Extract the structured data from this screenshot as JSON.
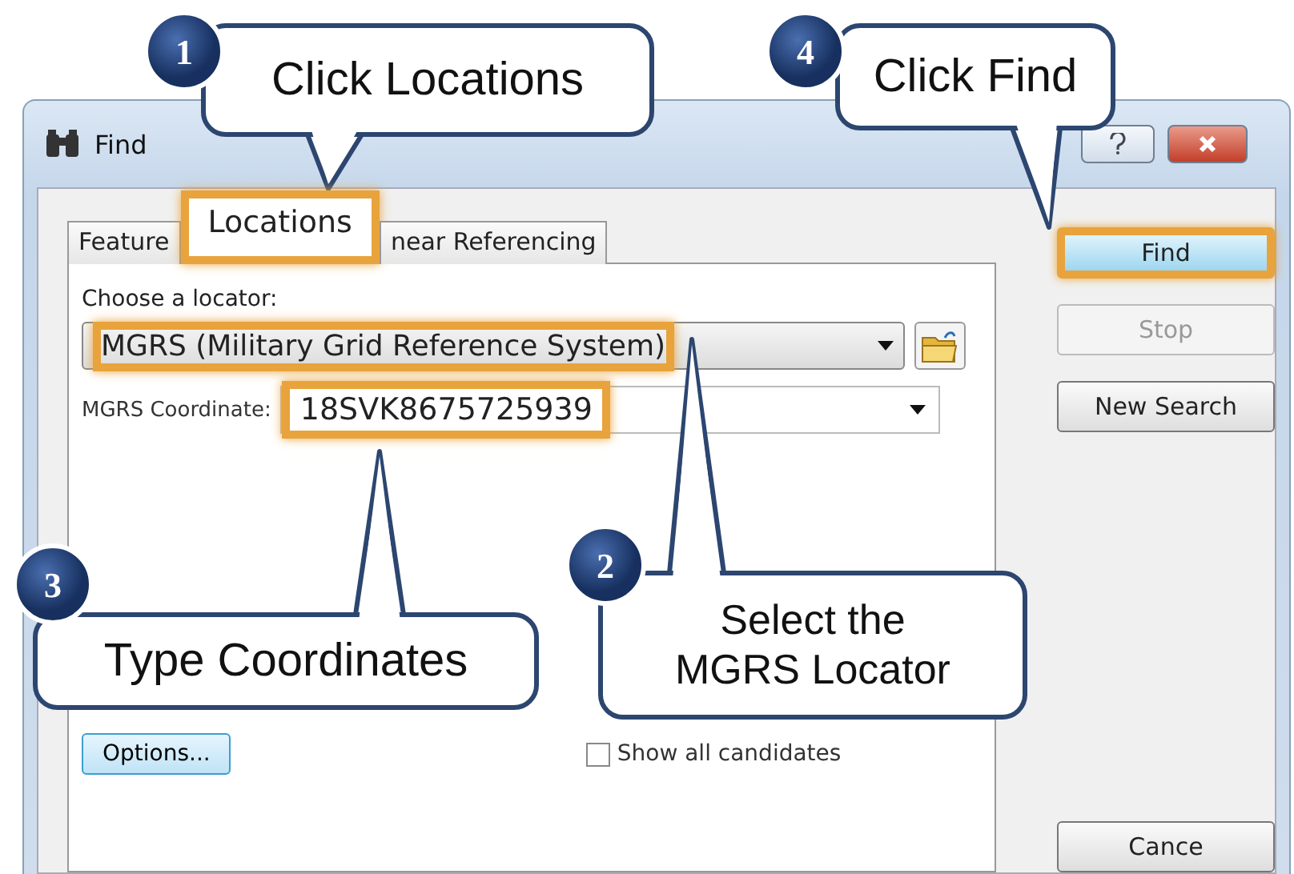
{
  "window": {
    "title": "Find"
  },
  "tabs": [
    {
      "label": "Feature",
      "selected": false,
      "highlighted": false
    },
    {
      "label": "Locations",
      "selected": true,
      "highlighted": true
    },
    {
      "label": "near Referencing",
      "selected": false,
      "highlighted": false
    }
  ],
  "locator": {
    "label": "Choose a locator:",
    "value": "MGRS (Military Grid Reference System)",
    "highlighted": true
  },
  "coordinate": {
    "label": "MGRS Coordinate:",
    "value": "18SVK8675725939",
    "highlighted": true
  },
  "options_button": "Options...",
  "show_all": {
    "label": "Show all candidates",
    "checked": false
  },
  "buttons": [
    {
      "label": "Find",
      "kind": "default",
      "highlighted": true,
      "disabled": false
    },
    {
      "label": "Stop",
      "kind": "normal",
      "highlighted": false,
      "disabled": true
    },
    {
      "label": "New Search",
      "kind": "normal",
      "highlighted": false,
      "disabled": false
    },
    {
      "label": "Cance",
      "kind": "normal",
      "highlighted": false,
      "disabled": false
    }
  ],
  "callouts": [
    {
      "number": "1",
      "text": "Click Locations"
    },
    {
      "number": "4",
      "text": "Click Find"
    },
    {
      "number": "3",
      "text": "Type Coordinates"
    },
    {
      "number": "2",
      "text": "Select the MGRS Locator"
    }
  ]
}
